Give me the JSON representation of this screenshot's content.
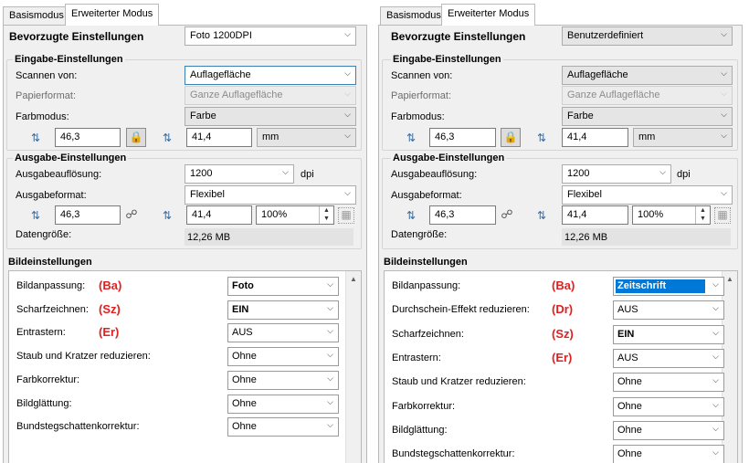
{
  "tabs": {
    "basic": "Basismodus",
    "advanced": "Erweiterter Modus"
  },
  "labels": {
    "preferred": "Bevorzugte Einstellungen",
    "input_section": "Eingabe-Einstellungen",
    "scan_from": "Scannen von:",
    "paper_format": "Papierformat:",
    "color_mode": "Farbmodus:",
    "output_section": "Ausgabe-Einstellungen",
    "output_resolution": "Ausgabeauflösung:",
    "output_format": "Ausgabeformat:",
    "data_size": "Datengröße:",
    "image_settings": "Bildeinstellungen",
    "dpi": "dpi"
  },
  "left": {
    "preferred_value": "Foto 1200DPI",
    "scan_from_value": "Auflagefläche",
    "paper_format_value": "Ganze Auflagefläche",
    "color_mode_value": "Farbe",
    "in_width": "46,3",
    "in_height": "41,4",
    "unit": "mm",
    "resolution": "1200",
    "output_format_value": "Flexibel",
    "out_width": "46,3",
    "out_height": "41,4",
    "scale": "100%",
    "data_size_value": "12,26 MB",
    "rows": [
      {
        "label": "Bildanpassung:",
        "code": "(Ba)",
        "value": "Foto",
        "bold": true
      },
      {
        "label": "Scharfzeichnen:",
        "code": "(Sz)",
        "value": "EIN",
        "bold": true
      },
      {
        "label": "Entrastern:",
        "code": "(Er)",
        "value": "AUS",
        "bold": false
      },
      {
        "label": "Staub und Kratzer reduzieren:",
        "code": "",
        "value": "Ohne",
        "bold": false
      },
      {
        "label": "Farbkorrektur:",
        "code": "",
        "value": "Ohne",
        "bold": false
      },
      {
        "label": "Bildglättung:",
        "code": "",
        "value": "Ohne",
        "bold": false
      },
      {
        "label": "Bundstegschattenkorrektur:",
        "code": "",
        "value": "Ohne",
        "bold": false
      }
    ]
  },
  "right": {
    "preferred_value": "Benutzerdefiniert",
    "scan_from_value": "Auflagefläche",
    "paper_format_value": "Ganze Auflagefläche",
    "color_mode_value": "Farbe",
    "in_width": "46,3",
    "in_height": "41,4",
    "unit": "mm",
    "resolution": "1200",
    "output_format_value": "Flexibel",
    "out_width": "46,3",
    "out_height": "41,4",
    "scale": "100%",
    "data_size_value": "12,26 MB",
    "rows": [
      {
        "label": "Bildanpassung:",
        "code": "(Ba)",
        "value": "Zeitschrift",
        "bold": true
      },
      {
        "label": "Durchschein-Effekt reduzieren:",
        "code": "(Dr)",
        "value": "AUS",
        "bold": false
      },
      {
        "label": "Scharfzeichnen:",
        "code": "(Sz)",
        "value": "EIN",
        "bold": true
      },
      {
        "label": "Entrastern:",
        "code": "(Er)",
        "value": "AUS",
        "bold": false
      },
      {
        "label": "Staub und Kratzer reduzieren:",
        "code": "",
        "value": "Ohne",
        "bold": false
      },
      {
        "label": "Farbkorrektur:",
        "code": "",
        "value": "Ohne",
        "bold": false
      },
      {
        "label": "Bildglättung:",
        "code": "",
        "value": "Ohne",
        "bold": false
      },
      {
        "label": "Bundstegschattenkorrektur:",
        "code": "",
        "value": "Ohne",
        "bold": false
      }
    ]
  },
  "colors": {
    "code_red": "#e02020",
    "highlight_blue": "#0078d7",
    "panel_bg": "#f0f0f0"
  }
}
